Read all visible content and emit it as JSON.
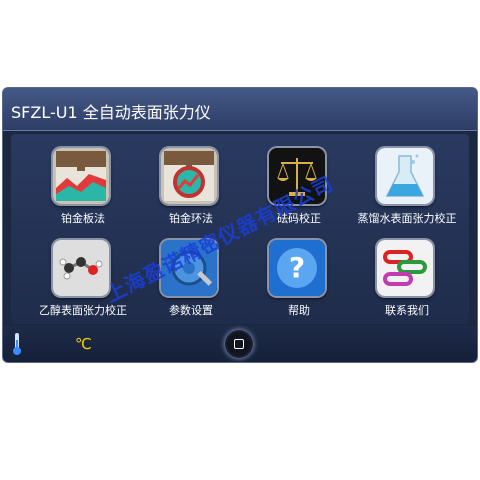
{
  "window": {
    "title": "SFZL-U1 全自动表面张力仪"
  },
  "menu": {
    "items": [
      {
        "label": "铂金板法",
        "icon": "platinum-plate-icon"
      },
      {
        "label": "铂金环法",
        "icon": "platinum-ring-icon"
      },
      {
        "label": "砝码校正",
        "icon": "balance-scale-icon"
      },
      {
        "label": "蒸馏水表面张力校正",
        "icon": "flask-icon"
      },
      {
        "label": "乙醇表面张力校正",
        "icon": "molecule-icon"
      },
      {
        "label": "参数设置",
        "icon": "settings-tools-icon"
      },
      {
        "label": "帮助",
        "icon": "help-icon"
      },
      {
        "label": "联系我们",
        "icon": "contact-links-icon"
      }
    ]
  },
  "status": {
    "temperature_unit": "℃",
    "temperature_icon": "thermometer-icon",
    "home_icon": "home-icon"
  },
  "watermark": {
    "text": "上海盈诺精密仪器有限公司"
  },
  "colors": {
    "title_bg": "#3b4d7a",
    "panel_bg": "#24345a",
    "unit_color": "#f5d000",
    "watermark": "#1a3fd9"
  }
}
